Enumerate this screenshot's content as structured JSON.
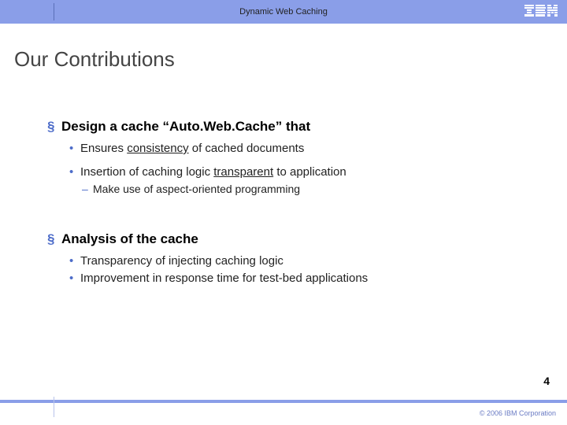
{
  "header": {
    "title": "Dynamic Web Caching",
    "logo": "IBM"
  },
  "slide": {
    "title": "Our Contributions",
    "page_number": "4"
  },
  "bullets": {
    "b1": {
      "text": "Design a cache “Auto.Web.Cache” that",
      "sub1_pre": "Ensures ",
      "sub1_u": "consistency",
      "sub1_post": " of cached documents",
      "sub2_pre": "Insertion of caching logic ",
      "sub2_u": "transparent",
      "sub2_post": " to application",
      "sub2_sub": "Make use of aspect-oriented programming"
    },
    "b2": {
      "text": "Analysis of the cache",
      "sub1": "Transparency of injecting caching logic",
      "sub2": "Improvement in response time for test-bed applications"
    }
  },
  "footer": {
    "copyright": "© 2006 IBM Corporation"
  }
}
